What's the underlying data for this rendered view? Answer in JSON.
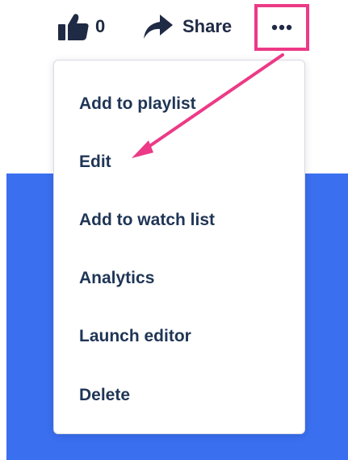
{
  "actions": {
    "like_icon": "thumbs-up-icon",
    "like_count": "0",
    "share_icon": "share-arrow-icon",
    "share_label": "Share",
    "more_icon": "more-options-icon"
  },
  "menu": {
    "items": [
      {
        "label": "Add to playlist"
      },
      {
        "label": "Edit"
      },
      {
        "label": "Add to watch list"
      },
      {
        "label": "Analytics"
      },
      {
        "label": "Launch editor"
      },
      {
        "label": "Delete"
      }
    ]
  },
  "annotation": {
    "highlight_color": "#ec3a86",
    "points_to": "Edit"
  },
  "colors": {
    "text": "#1f2a44",
    "panel_blue": "#3a6ff0",
    "highlight": "#ec3a86"
  }
}
